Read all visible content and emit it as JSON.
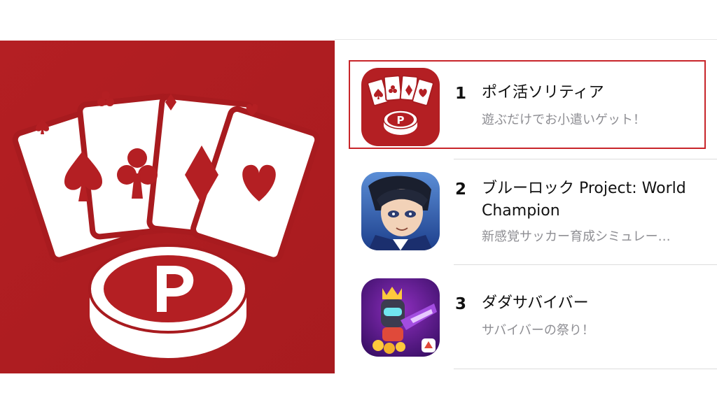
{
  "colors": {
    "brand_red": "#b82226",
    "highlight": "#c8252a"
  },
  "hero": {
    "icon": "poker-cards-chip-icon",
    "chip_letter": "P"
  },
  "list": {
    "items": [
      {
        "rank": "1",
        "title": "ポイ活ソリティア",
        "subtitle": "遊ぶだけでお小遣いゲット！",
        "icon": "solitaire-app-icon",
        "chip_letter": "P"
      },
      {
        "rank": "2",
        "title": "ブルーロック Project: World Champion",
        "subtitle": "新感覚サッカー育成シミュレー…",
        "icon": "blue-lock-app-icon"
      },
      {
        "rank": "3",
        "title": "ダダサバイバー",
        "subtitle": "サバイバーの祭り！",
        "icon": "dada-survivor-app-icon"
      }
    ]
  }
}
